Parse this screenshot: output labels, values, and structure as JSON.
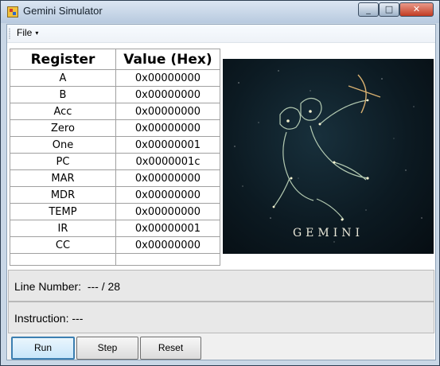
{
  "window": {
    "title": "Gemini Simulator",
    "controls": {
      "minimize": "_",
      "maximize": "□",
      "close": "✕"
    }
  },
  "menu": {
    "file_label": "File",
    "file_caret": "▾"
  },
  "registers": {
    "headers": [
      "Register",
      "Value (Hex)"
    ],
    "rows": [
      {
        "name": "A",
        "value": "0x00000000"
      },
      {
        "name": "B",
        "value": "0x00000000"
      },
      {
        "name": "Acc",
        "value": "0x00000000"
      },
      {
        "name": "Zero",
        "value": "0x00000000"
      },
      {
        "name": "One",
        "value": "0x00000001"
      },
      {
        "name": "PC",
        "value": "0x0000001c"
      },
      {
        "name": "MAR",
        "value": "0x00000000"
      },
      {
        "name": "MDR",
        "value": "0x00000000"
      },
      {
        "name": "TEMP",
        "value": "0x00000000"
      },
      {
        "name": "IR",
        "value": "0x00000001"
      },
      {
        "name": "CC",
        "value": "0x00000000"
      }
    ]
  },
  "image": {
    "caption": "GEMINI"
  },
  "status": {
    "line_number": "Line Number:  --- / 28",
    "instruction": "Instruction: ---"
  },
  "buttons": {
    "run": "Run",
    "step": "Step",
    "reset": "Reset"
  },
  "colors": {
    "accent": "#3c7fb1",
    "close": "#c23b22",
    "titlebar": "#c9d7e6"
  }
}
